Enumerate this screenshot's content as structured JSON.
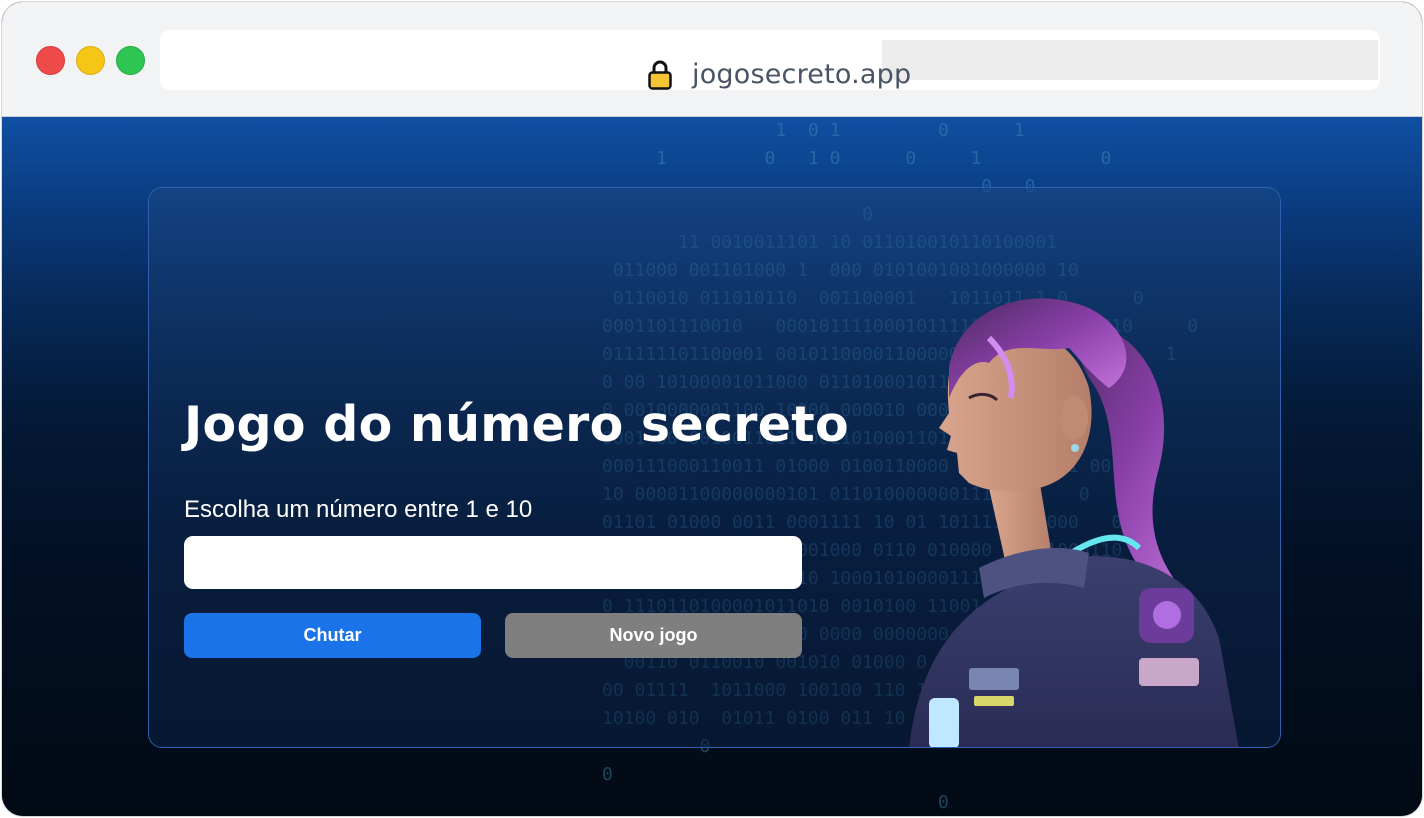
{
  "browser": {
    "url": "jogosecreto.app"
  },
  "game": {
    "title": "Jogo do número secreto",
    "instruction": "Escolha um número entre 1 e 10",
    "input_value": "",
    "guess_button": "Chutar",
    "new_game_button": "Novo jogo"
  },
  "colors": {
    "primary_button": "#1a73e8",
    "secondary_button": "#7f7f7f",
    "background_top": "#0f4fa2",
    "background_bottom": "#020a14"
  },
  "icons": {
    "address_lock": "lock-icon"
  }
}
